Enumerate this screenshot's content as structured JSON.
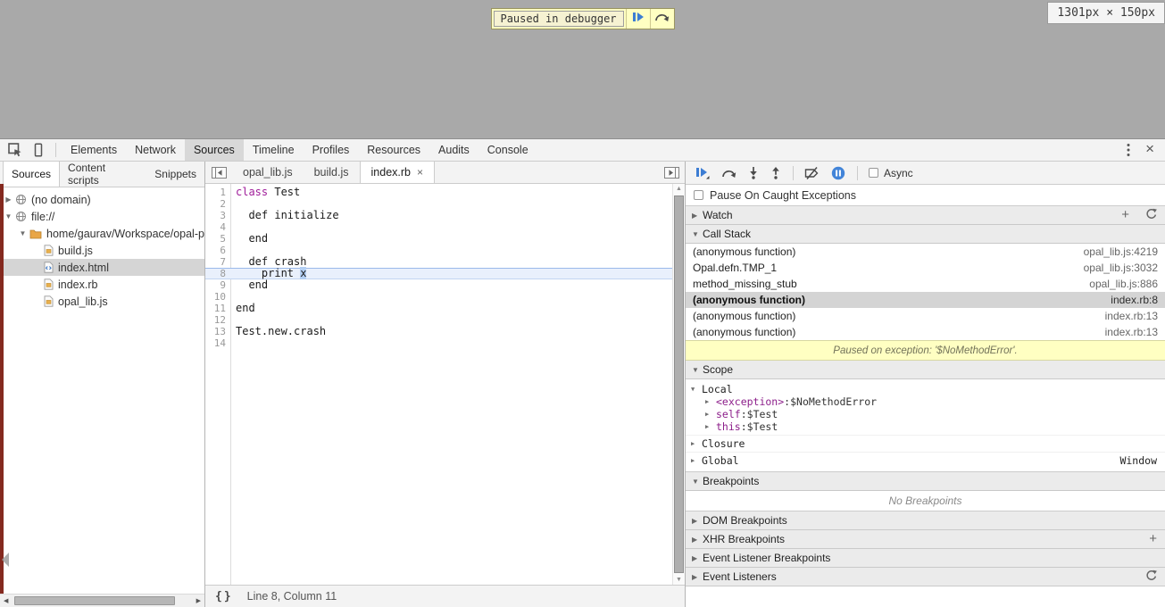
{
  "page": {
    "paused_label": "Paused in debugger",
    "dimension_tooltip": "1301px × 150px"
  },
  "toolbar": {
    "tabs": [
      {
        "label": "Elements"
      },
      {
        "label": "Network"
      },
      {
        "label": "Sources",
        "active": true
      },
      {
        "label": "Timeline"
      },
      {
        "label": "Profiles"
      },
      {
        "label": "Resources"
      },
      {
        "label": "Audits"
      },
      {
        "label": "Console"
      }
    ]
  },
  "sidebar": {
    "tabs": [
      {
        "label": "Sources",
        "active": true
      },
      {
        "label": "Content scripts"
      },
      {
        "label": "Snippets"
      }
    ],
    "tree": [
      {
        "label": "(no domain)",
        "icon": "globe",
        "arrow": "collapsed",
        "depth": 0
      },
      {
        "label": "file://",
        "icon": "globe",
        "arrow": "expanded",
        "depth": 0
      },
      {
        "label": "home/gaurav/Workspace/opal-pl",
        "icon": "folder",
        "arrow": "expanded",
        "depth": 1
      },
      {
        "label": "build.js",
        "icon": "file",
        "depth": 2
      },
      {
        "label": "index.html",
        "icon": "file-html",
        "depth": 2,
        "selected": true
      },
      {
        "label": "index.rb",
        "icon": "file",
        "depth": 2
      },
      {
        "label": "opal_lib.js",
        "icon": "file",
        "depth": 2
      }
    ]
  },
  "editor": {
    "tabs": [
      {
        "label": "opal_lib.js"
      },
      {
        "label": "build.js"
      },
      {
        "label": "index.rb",
        "active": true
      }
    ],
    "lines": [
      {
        "segs": [
          {
            "t": "class",
            "cls": "kw"
          },
          {
            "t": " Test"
          }
        ]
      },
      {
        "segs": []
      },
      {
        "segs": [
          {
            "t": "  def initialize"
          }
        ]
      },
      {
        "segs": []
      },
      {
        "segs": [
          {
            "t": "  end"
          }
        ]
      },
      {
        "segs": []
      },
      {
        "segs": [
          {
            "t": "  def crash"
          }
        ]
      },
      {
        "segs": [
          {
            "t": "    print "
          },
          {
            "t": "x",
            "cls": "selx"
          }
        ],
        "exec": true
      },
      {
        "segs": [
          {
            "t": "  end"
          }
        ]
      },
      {
        "segs": []
      },
      {
        "segs": [
          {
            "t": "end"
          }
        ]
      },
      {
        "segs": []
      },
      {
        "segs": [
          {
            "t": "Test.new.crash"
          }
        ]
      },
      {
        "segs": []
      }
    ],
    "status": "Line 8, Column 11"
  },
  "debugger": {
    "async_label": "Async",
    "pause_on_caught_label": "Pause On Caught Exceptions",
    "watch": {
      "title": "Watch"
    },
    "call_stack": {
      "title": "Call Stack",
      "frames": [
        {
          "name": "(anonymous function)",
          "location": "opal_lib.js:4219"
        },
        {
          "name": "Opal.defn.TMP_1",
          "location": "opal_lib.js:3032"
        },
        {
          "name": "method_missing_stub",
          "location": "opal_lib.js:886"
        },
        {
          "name": "(anonymous function)",
          "location": "index.rb:8",
          "selected": true
        },
        {
          "name": "(anonymous function)",
          "location": "index.rb:13"
        },
        {
          "name": "(anonymous function)",
          "location": "index.rb:13"
        }
      ]
    },
    "exception_banner": "Paused on exception: '$NoMethodError'.",
    "scope": {
      "title": "Scope",
      "rows": [
        {
          "label": "Local",
          "state": "expanded",
          "depth": 0
        },
        {
          "name": "<exception>",
          "value": "$NoMethodError",
          "state": "collapsed",
          "depth": 1
        },
        {
          "name": "self",
          "value": "$Test",
          "state": "collapsed",
          "depth": 1
        },
        {
          "name": "this",
          "value": "$Test",
          "state": "collapsed",
          "depth": 1
        },
        {
          "label": "Closure",
          "state": "collapsed",
          "depth": 0
        },
        {
          "label": "Global",
          "state": "collapsed",
          "depth": 0,
          "right": "Window"
        }
      ]
    },
    "breakpoints": {
      "title": "Breakpoints",
      "state": "expanded",
      "empty_text": "No Breakpoints"
    },
    "sections": [
      {
        "title": "DOM Breakpoints",
        "state": "collapsed"
      },
      {
        "title": "XHR Breakpoints",
        "state": "collapsed",
        "action": "add"
      },
      {
        "title": "Event Listener Breakpoints",
        "state": "collapsed"
      },
      {
        "title": "Event Listeners",
        "state": "collapsed",
        "action": "refresh"
      }
    ]
  },
  "colors": {
    "accent_blue": "#4284d8",
    "keyword_magenta": "#a01d9a",
    "execution_line_bg": "#e9f0fc",
    "exception_yellow": "#ffffc2",
    "overlay_scrollbar_red": "#84291f"
  }
}
